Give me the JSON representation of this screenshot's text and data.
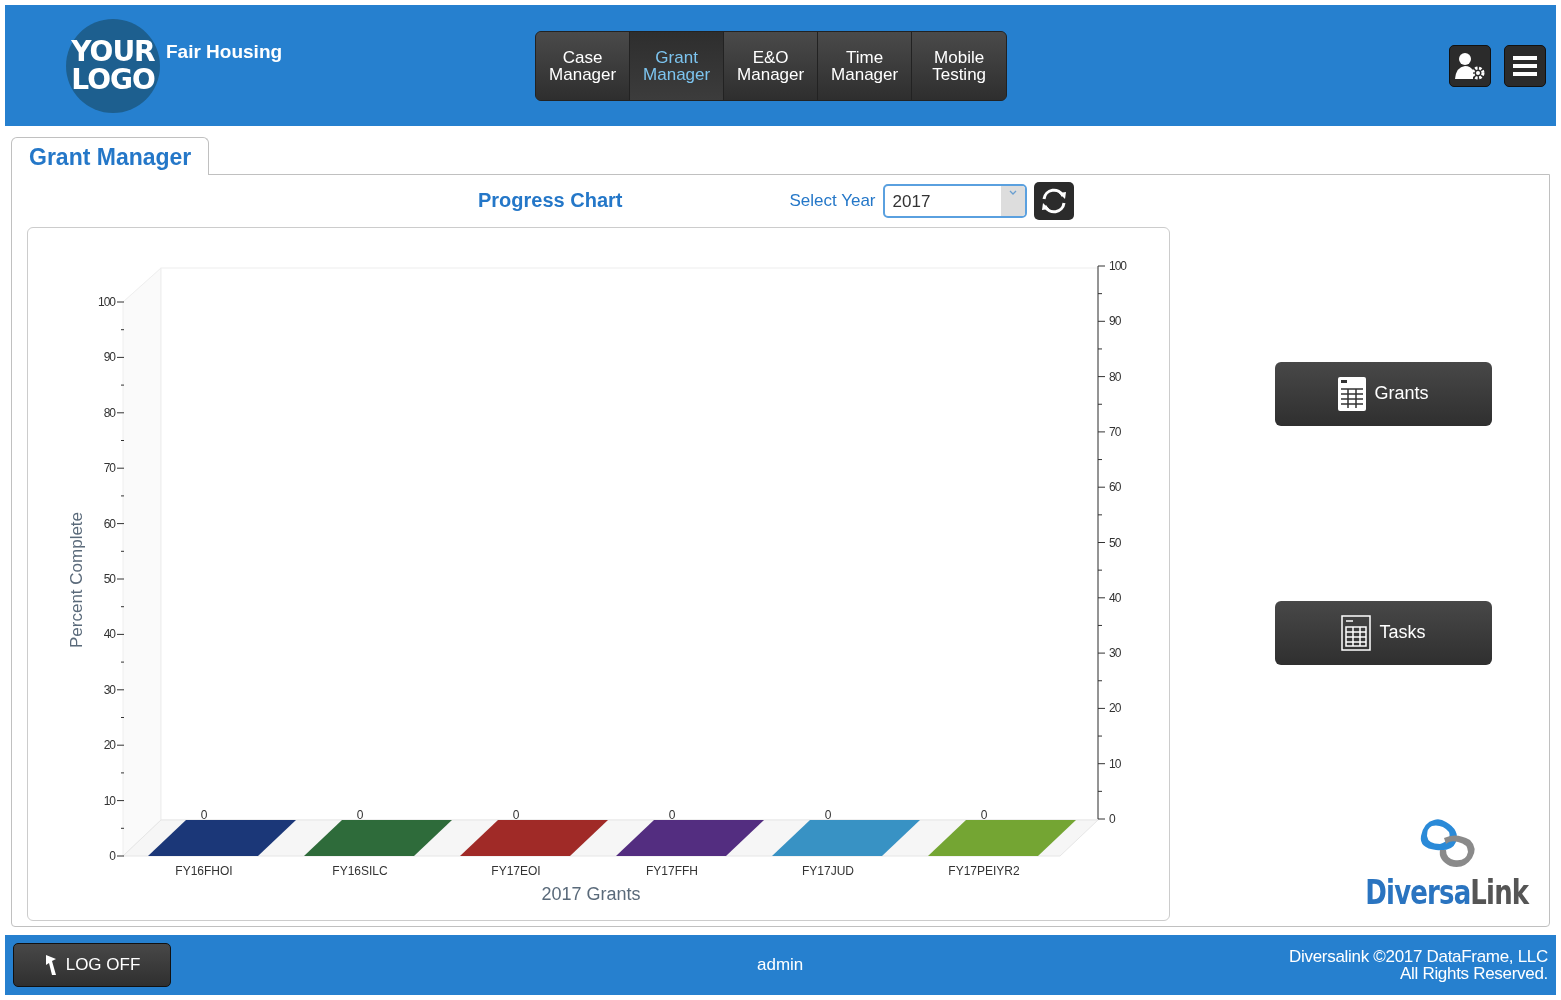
{
  "header": {
    "logo_text": "YOUR LOGO",
    "app_name": "Fair Housing",
    "nav": [
      {
        "label": "Case Manager",
        "selected": false
      },
      {
        "label": "Grant Manager",
        "selected": true
      },
      {
        "label": "E&O Manager",
        "selected": false
      },
      {
        "label": "Time Manager",
        "selected": false
      },
      {
        "label": "Mobile Testing",
        "selected": false
      }
    ]
  },
  "page_tabs": [
    {
      "label": "Grant Manager",
      "selected": true
    }
  ],
  "toolbar": {
    "title": "Progress Chart",
    "year_label": "Select Year",
    "year_value": "2017"
  },
  "chart": {
    "chart_data": {
      "type": "bar",
      "xlabel": "2017 Grants",
      "ylabel": "Percent Complete",
      "categories": [
        "FY16FHOI",
        "FY16SILC",
        "FY17EOI",
        "FY17FFH",
        "FY17JUD",
        "FY17PEIYR2"
      ],
      "series": [
        {
          "colors": [
            "#1b3778",
            "#2e6b3a",
            "#a02a27",
            "#532d80",
            "#3892c4",
            "#74a533"
          ],
          "values": [
            0,
            0,
            0,
            0,
            0,
            0
          ]
        }
      ],
      "ylim": [
        0,
        100
      ],
      "yticks": [
        0,
        10,
        20,
        30,
        40,
        50,
        60,
        70,
        80,
        90,
        100
      ],
      "data_labels": true
    },
    "left_axis_ticks": [
      "100",
      "90",
      "80",
      "70",
      "60",
      "50",
      "40",
      "30",
      "20",
      "10",
      "0"
    ]
  },
  "side_buttons": [
    {
      "label": "Grants",
      "kind": "grants"
    },
    {
      "label": "Tasks",
      "kind": "tasks"
    }
  ],
  "brand": {
    "first": "Diversa",
    "second": "Link"
  },
  "footer": {
    "logoff": "LOG OFF",
    "user": "admin",
    "copyright": [
      "Diversalink ©2017 DataFrame, LLC",
      "All Rights Reserved."
    ]
  }
}
